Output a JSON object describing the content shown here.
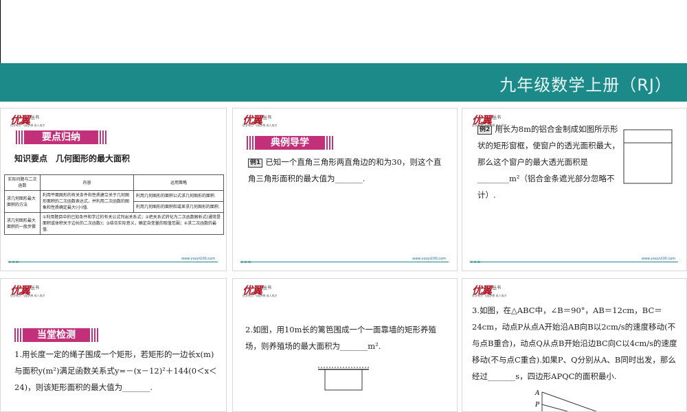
{
  "header": {
    "title": "九年级数学上册（RJ）"
  },
  "logo": {
    "main": "优翼",
    "sub": "丛书",
    "tagline": "优学有方 飞翔梦想 成人成才"
  },
  "footer": {
    "url": "www.youyi100.com"
  },
  "slide1": {
    "ribbon": "要点归纳",
    "heading": "知识要点　几何图形的最大面积",
    "table": {
      "headers": [
        "实际问题与二次函数",
        "内容",
        "运用策略"
      ],
      "rows": [
        {
          "label": "求几何图形最大面积的方法",
          "content": "利用平面图形的有关条件和性质建立关于几何图形面积的二次函数表达式，并利用二次函数的图象和性质确定最大(小)值.",
          "strategy1": "利用几何图形的面积公式求几何图形的面积.",
          "strategy2": "利用几何图形的面积和或差求几何图形的面积."
        },
        {
          "label": "求几何图形最大面积的一般步骤",
          "content": "①利用题目中的已知条件和学过的有关公式列出关系式；②把关系式转化为二次函数解析式(通常是面积或体积关于边长的二次函数)；③结合实际意义，确定自变量的取值范围；④求二次函数的最值."
        }
      ]
    }
  },
  "slide2": {
    "ribbon": "典例导学",
    "badge": "例1",
    "text": "已知一个直角三角形两直角边的和为30，则这个直角三角形面积的最大值为_______."
  },
  "slide3": {
    "badge": "例2",
    "text": "用长为8m的铝合金制成如图所示形状的矩形窗框，使窗户的透光面积最大，那么这个窗户的最大透光面积是________m²（铝合金条遮光部分忽略不计）."
  },
  "slide4": {
    "ribbon": "当堂检测",
    "text": "1.用长度一定的绳子围成一个矩形，若矩形的一边长x(m)与面积y(m²)满足函数关系式y=－(x－12)²＋144(0＜x＜24)，则该矩形面积的最大值为_______."
  },
  "slide5": {
    "text": "2.如图，用10m长的篱笆围成一个一面靠墙的矩形养殖场，则养殖场的最大面积为_______m²."
  },
  "slide6": {
    "text": "3.如图，在△ABC中，∠B＝90°，AB＝12cm，BC＝24cm，动点P从点A开始沿AB向B以2cm/s的速度移动(不与点B重合)，动点Q从点B开始沿边BC向C以4cm/s的速度移动(不与点C重合).如果P、Q分别从A、B同时出发，那么经过_______s，四边形APQC的面积最小.",
    "label_a": "A",
    "label_p": "P"
  }
}
